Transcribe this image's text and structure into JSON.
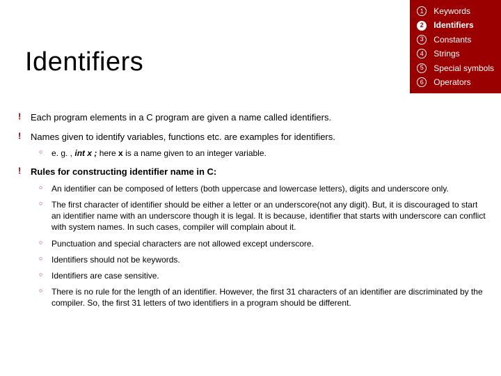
{
  "title": "Identifiers",
  "legend": [
    {
      "num": "1",
      "label": "Keywords",
      "active": false
    },
    {
      "num": "2",
      "label": "Identifiers",
      "active": true
    },
    {
      "num": "3",
      "label": "Constants",
      "active": false
    },
    {
      "num": "4",
      "label": "Strings",
      "active": false
    },
    {
      "num": "5",
      "label": "Special symbols",
      "active": false
    },
    {
      "num": "6",
      "label": "Operators",
      "active": false
    }
  ],
  "bullets": {
    "b1": "Each program elements in a C program are given a name called identifiers.",
    "b2": "Names given to identify variables, functions etc. are examples for identifiers.",
    "b2_1_pre": "e. g. , ",
    "b2_1_code": "int  x ;",
    "b2_1_mid": "  here  ",
    "b2_1_var": "x",
    "b2_1_post": " is a name given to an integer variable.",
    "b3": "Rules for constructing identifier name in C:",
    "b3_1": "An identifier can be composed of letters (both uppercase and lowercase letters), digits and underscore only.",
    "b3_2": "The first character of identifier should be either a letter or an underscore(not any digit). But, it is discouraged to start an identifier name with an underscore though it is legal. It is because, identifier that starts with underscore can conflict with system names. In such cases, compiler will complain about it.",
    "b3_3": "Punctuation and special characters are not allowed except underscore.",
    "b3_4": "Identifiers should not be keywords.",
    "b3_5": "Identifiers are case sensitive.",
    "b3_6": "There is no rule for the length of an identifier. However, the first 31 characters of an identifier are discriminated by the compiler. So, the first 31 letters of two identifiers in a program should be different."
  }
}
